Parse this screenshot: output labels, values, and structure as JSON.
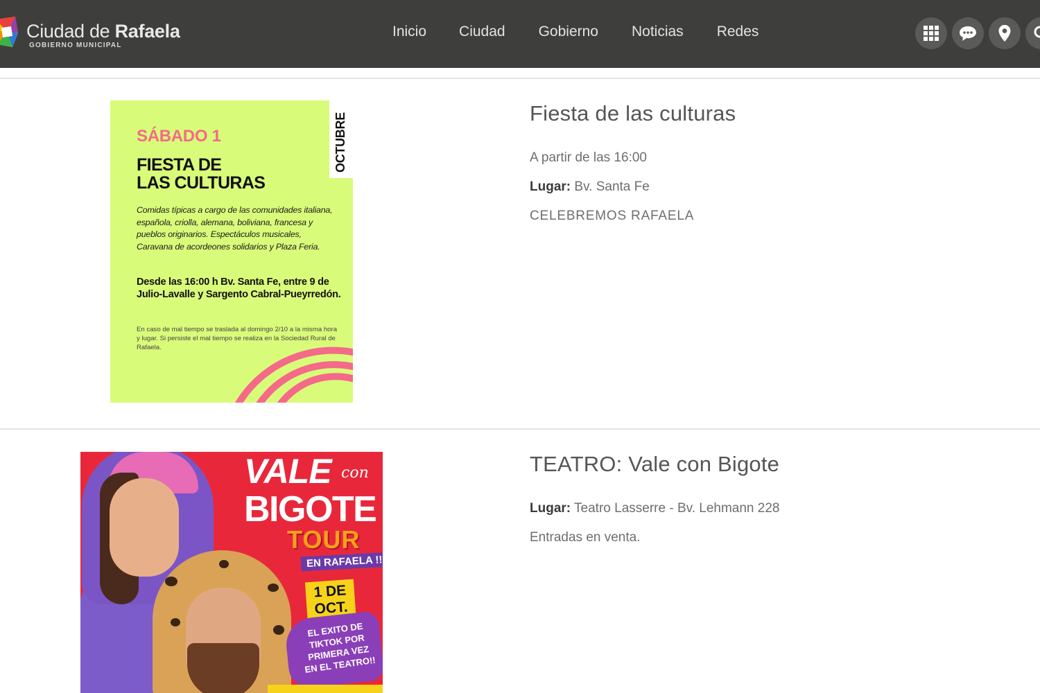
{
  "header": {
    "brand_name_regular": "Ciudad de ",
    "brand_name_bold": "Rafaela",
    "brand_subtitle": "GOBIERNO MUNICIPAL",
    "nav": [
      "Inicio",
      "Ciudad",
      "Gobierno",
      "Noticias",
      "Redes"
    ],
    "icons": [
      "grid-icon",
      "chat-icon",
      "location-pin-icon",
      "search-icon"
    ],
    "colors": {
      "bar": "#3e3e3c",
      "text": "#e4e4e4",
      "icon_bg": "#5a5a58"
    }
  },
  "events": [
    {
      "title": "Fiesta de las culturas",
      "time": "A partir de las 16:00",
      "place_label": "Lugar:",
      "place": "Bv. Santa Fe",
      "tag": "CELEBREMOS RAFAELA",
      "poster": {
        "day": "SÁBADO 1",
        "month": "OCTUBRE",
        "title": "FIESTA DE\nLAS CULTURAS",
        "description": "Comidas típicas a cargo de las comunidades italiana, española, criolla, alemana, boliviana, francesa y pueblos originarios. Espectáculos musicales, Caravana de acordeones solidarios y Plaza Feria.",
        "time_and_place": "Desde las 16:00 h Bv. Santa Fe, entre 9 de Julio-Lavalle y Sargento Cabral-Pueyrredón.",
        "note": "En caso de mal tiempo se traslada al domingo 2/10 a la misma hora y lugar. Si persiste el mal tiempo se realiza en la Sociedad Rural de Rafaela.",
        "colors": {
          "background": "#d9fb7a",
          "accent": "#f46a88"
        }
      }
    },
    {
      "title": "TEATRO: Vale con Bigote",
      "place_label": "Lugar:",
      "place": "Teatro Lasserre - Bv. Lehmann 228",
      "info": "Entradas en venta.",
      "poster": {
        "line1": "VALE",
        "con": "con",
        "line2": "BIGOTE",
        "tour": "TOUR",
        "location": "EN RAFAELA !!!",
        "date": "1 DE\nOCT.",
        "tagline": "EL EXITO DE\nTIKTOK POR\nPRIMERA VEZ\nEN EL TEATRO!!",
        "colors": {
          "background": "#e8283a",
          "tour": "#f6a01a",
          "date_bg": "#f7d21a",
          "tag_bg": "#8a3fb8"
        }
      }
    }
  ]
}
